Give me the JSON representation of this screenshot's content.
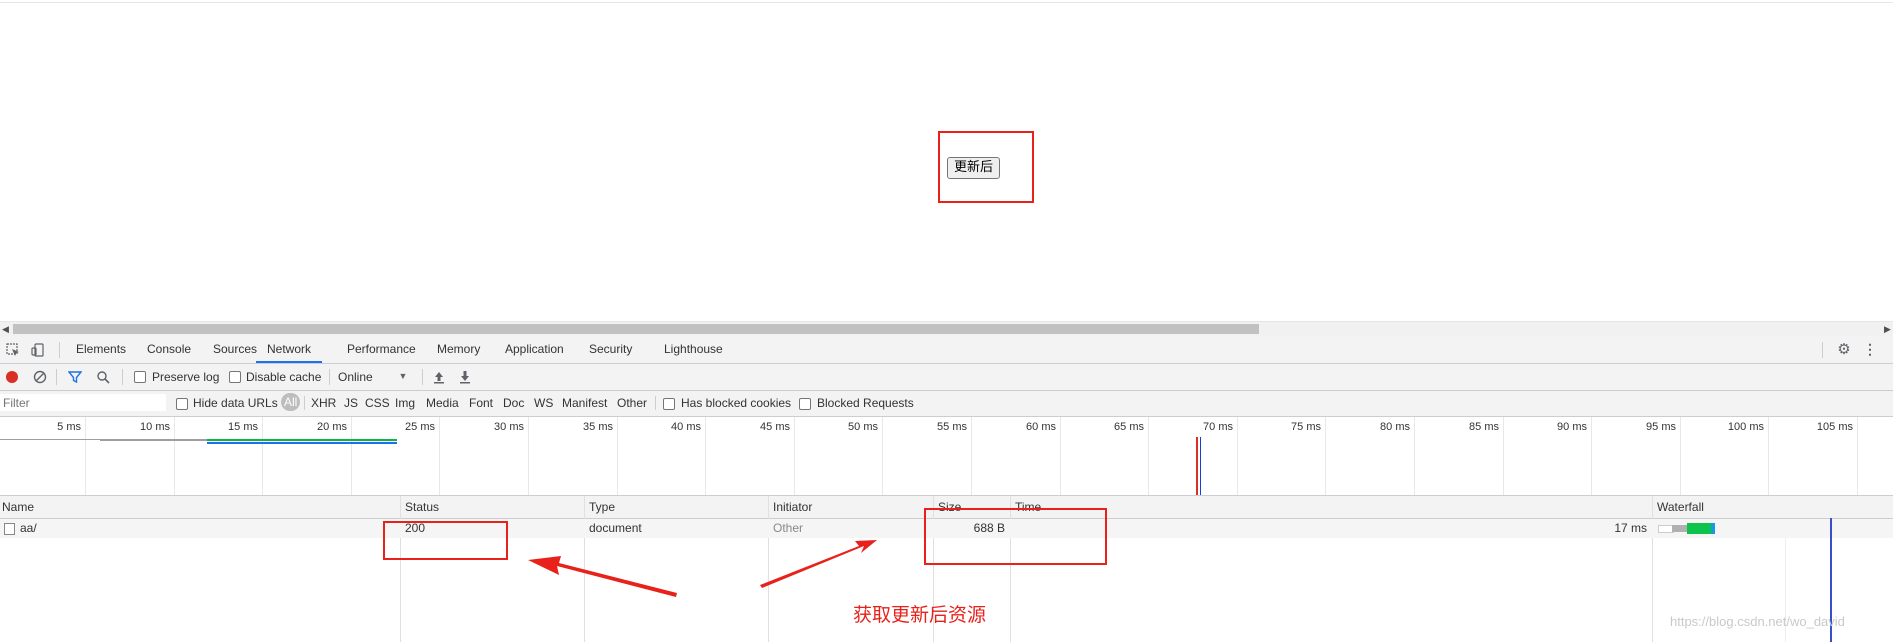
{
  "page": {
    "button_label": "更新后"
  },
  "devtools": {
    "tabs": [
      {
        "label": "Elements",
        "active": false
      },
      {
        "label": "Console",
        "active": false
      },
      {
        "label": "Sources",
        "active": false
      },
      {
        "label": "Network",
        "active": true
      },
      {
        "label": "Performance",
        "active": false
      },
      {
        "label": "Memory",
        "active": false
      },
      {
        "label": "Application",
        "active": false
      },
      {
        "label": "Security",
        "active": false
      },
      {
        "label": "Lighthouse",
        "active": false
      }
    ],
    "toolbar": {
      "preserve_log": "Preserve log",
      "disable_cache": "Disable cache",
      "throttling": "Online"
    },
    "filter": {
      "placeholder": "Filter",
      "hide_data_urls": "Hide data URLs",
      "types": [
        "All",
        "XHR",
        "JS",
        "CSS",
        "Img",
        "Media",
        "Font",
        "Doc",
        "WS",
        "Manifest",
        "Other"
      ],
      "has_blocked_cookies": "Has blocked cookies",
      "blocked_requests": "Blocked Requests"
    },
    "overview_ticks": [
      "5 ms",
      "10 ms",
      "15 ms",
      "20 ms",
      "25 ms",
      "30 ms",
      "35 ms",
      "40 ms",
      "45 ms",
      "50 ms",
      "55 ms",
      "60 ms",
      "65 ms",
      "70 ms",
      "75 ms",
      "80 ms",
      "85 ms",
      "90 ms",
      "95 ms",
      "100 ms",
      "105 ms"
    ],
    "columns": {
      "name": "Name",
      "status": "Status",
      "type": "Type",
      "initiator": "Initiator",
      "size": "Size",
      "time": "Time",
      "waterfall": "Waterfall"
    },
    "requests": [
      {
        "name": "aa/",
        "status": "200",
        "type": "document",
        "initiator": "Other",
        "size": "688 B",
        "time": "17 ms"
      }
    ]
  },
  "annotation": {
    "text": "获取更新后资源"
  },
  "watermark": "https://blog.csdn.net/wo_david",
  "colors": {
    "annotation_red": "#e8221b",
    "active_tab_blue": "#1a73e8",
    "record_red": "#d93025"
  }
}
